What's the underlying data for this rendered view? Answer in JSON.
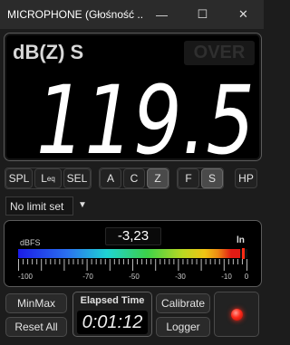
{
  "window": {
    "title": "MICROPHONE (Głośność ...",
    "minimize": "—",
    "maximize": "☐",
    "close": "✕"
  },
  "display": {
    "mode": "dB(Z) S",
    "over": "OVER",
    "value": "119.5"
  },
  "buttons": {
    "spl": "SPL",
    "leq_main": "L",
    "leq_sub": "eq",
    "sel": "SEL",
    "a": "A",
    "c": "C",
    "z": "Z",
    "f": "F",
    "s": "S",
    "hp": "HP"
  },
  "limit": {
    "value": "No limit set",
    "arrow": "▼"
  },
  "meter": {
    "unit": "dBFS",
    "readout": "-3,23",
    "mode": "ln",
    "level_fraction": 0.97,
    "scale": [
      "-100",
      "-70",
      "-50",
      "-30",
      "-10",
      "0"
    ]
  },
  "actions": {
    "minmax": "MinMax",
    "reset_all": "Reset All",
    "elapsed_label": "Elapsed Time",
    "elapsed_value": "0:01:12",
    "calibrate": "Calibrate",
    "logger": "Logger"
  }
}
